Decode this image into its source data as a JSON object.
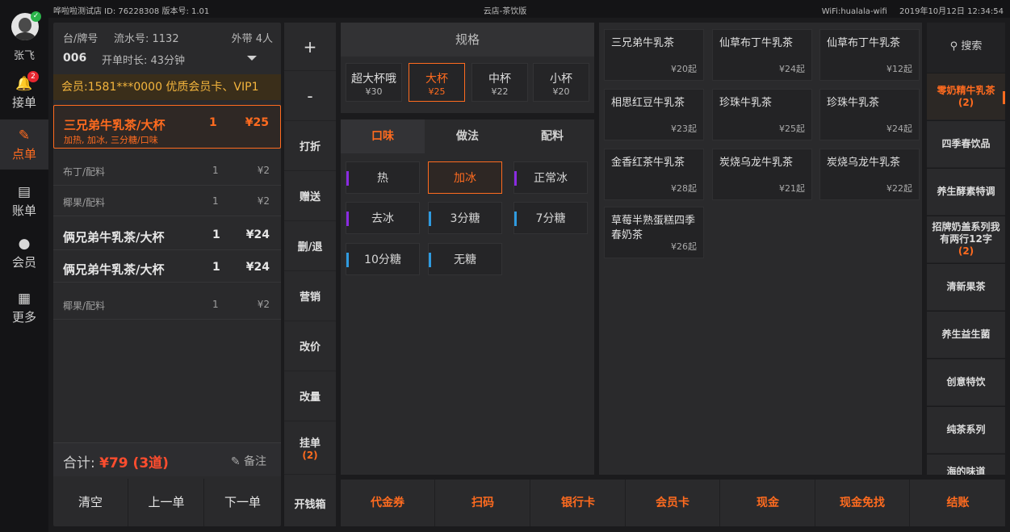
{
  "topbar": {
    "store_info": "哗啦啦测试店 ID: 76228308   版本号: 1.01",
    "center": "云店-茶饮版",
    "wifi": "WiFi:hualala-wifi",
    "datetime": "2019年10月12日 12:34:54"
  },
  "nav": {
    "user_name": "张飞",
    "items": [
      {
        "label": "接单",
        "icon": "bell-icon",
        "badge": "2"
      },
      {
        "label": "点单",
        "icon": "edit-icon"
      },
      {
        "label": "账单",
        "icon": "bill-icon"
      },
      {
        "label": "会员",
        "icon": "user-icon"
      },
      {
        "label": "更多",
        "icon": "grid-icon"
      }
    ]
  },
  "order": {
    "table_label": "台/牌号",
    "serial": "流水号: 1132",
    "takeout": "外带  4人",
    "table_no": "006",
    "duration": "开单时长: 43分钟",
    "member": "会员:1581***0000   优质会员卡、VIP1",
    "selected": {
      "name": "三兄弟牛乳茶/大杯",
      "qty": "1",
      "price": "¥25",
      "spec": "加热, 加冰, 三分糖/口味"
    },
    "rows": [
      {
        "name": "布丁/配料",
        "qty": "1",
        "price": "¥2"
      },
      {
        "name": "椰果/配料",
        "qty": "1",
        "price": "¥2"
      },
      {
        "name": "俩兄弟牛乳茶/大杯",
        "qty": "1",
        "price": "¥24"
      },
      {
        "name": "俩兄弟牛乳茶/大杯",
        "qty": "1",
        "price": "¥24"
      },
      {
        "name": "椰果/配料",
        "qty": "1",
        "price": "¥2"
      }
    ],
    "total_label": "合计: ",
    "total_value": "¥79 (3道)",
    "remark": "备注",
    "buttons": [
      "清空",
      "上一单",
      "下一单"
    ]
  },
  "actions": [
    "+",
    "-",
    "打折",
    "赠送",
    "删/退",
    "营销",
    "改价",
    "改量",
    "挂单",
    "开钱箱"
  ],
  "actions_hang_count": "(2)",
  "spec": {
    "title": "规格",
    "sizes": [
      {
        "name": "超大杯哦",
        "price": "¥30"
      },
      {
        "name": "大杯",
        "price": "¥25"
      },
      {
        "name": "中杯",
        "price": "¥22"
      },
      {
        "name": "小杯",
        "price": "¥20"
      }
    ]
  },
  "options": {
    "tabs": [
      "口味",
      "做法",
      "配料"
    ],
    "chips": [
      {
        "label": "热",
        "bar": "#8a2be2"
      },
      {
        "label": "加冰",
        "bar": ""
      },
      {
        "label": "正常冰",
        "bar": "#8a2be2"
      },
      {
        "label": "去冰",
        "bar": "#8a2be2"
      },
      {
        "label": "3分糖",
        "bar": "#2f9be0"
      },
      {
        "label": "7分糖",
        "bar": "#2f9be0"
      },
      {
        "label": "10分糖",
        "bar": "#2f9be0"
      },
      {
        "label": "无糖",
        "bar": "#2f9be0"
      }
    ]
  },
  "products": [
    {
      "name": "三兄弟牛乳茶",
      "price": "¥20起"
    },
    {
      "name": "仙草布丁牛乳茶",
      "price": "¥24起"
    },
    {
      "name": "仙草布丁牛乳茶",
      "price": "¥12起"
    },
    {
      "name": "相思红豆牛乳茶",
      "price": "¥23起"
    },
    {
      "name": "珍珠牛乳茶",
      "price": "¥25起"
    },
    {
      "name": "珍珠牛乳茶",
      "price": "¥24起"
    },
    {
      "name": "金香红茶牛乳茶",
      "price": "¥28起"
    },
    {
      "name": "炭烧乌龙牛乳茶",
      "price": "¥21起"
    },
    {
      "name": "炭烧乌龙牛乳茶",
      "price": "¥22起"
    },
    {
      "name": "草莓半熟蛋糕四季春奶茶",
      "price": "¥26起"
    }
  ],
  "categories": {
    "search": "搜索",
    "items": [
      {
        "label": "零奶精牛乳茶",
        "count": "(2)"
      },
      {
        "label": "四季春饮品",
        "count": ""
      },
      {
        "label": "养生酵素特调",
        "count": ""
      },
      {
        "label": "招牌奶盖系列我有两行12字",
        "count": "(2)"
      },
      {
        "label": "清新果茶",
        "count": ""
      },
      {
        "label": "养生益生菌",
        "count": ""
      },
      {
        "label": "创意特饮",
        "count": ""
      },
      {
        "label": "纯茶系列",
        "count": ""
      },
      {
        "label": "海的味道",
        "count": ""
      }
    ]
  },
  "payment": [
    "代金券",
    "扫码",
    "银行卡",
    "会员卡",
    "现金",
    "现金免找",
    "结账"
  ],
  "colors": {
    "accent": "#ff6b1f",
    "member": "#f4b53d",
    "total": "#ff4d2e"
  }
}
